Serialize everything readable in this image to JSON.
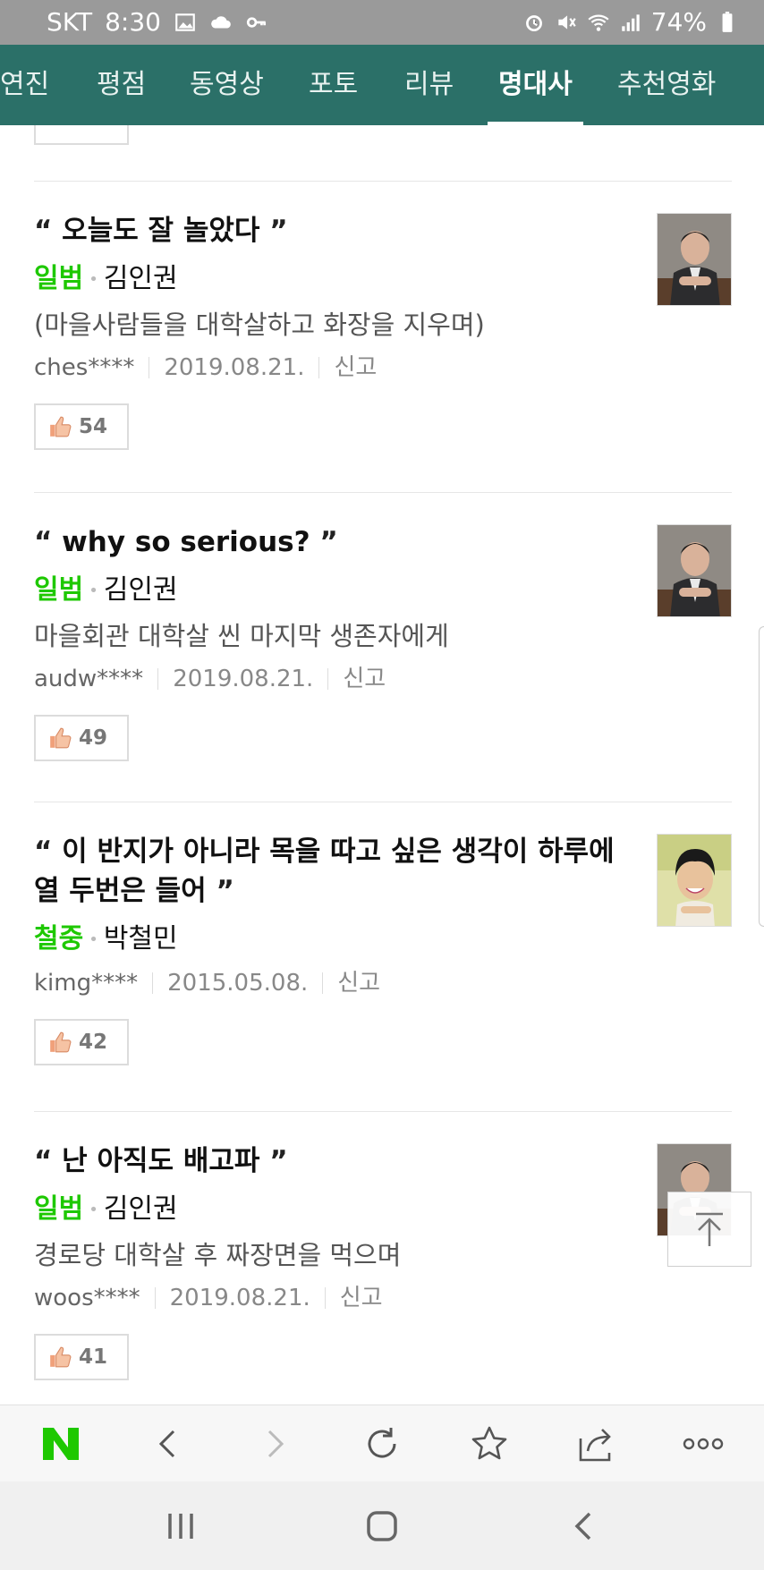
{
  "status_bar": {
    "carrier": "SKT",
    "time": "8:30",
    "battery": "74%"
  },
  "tabs": [
    {
      "label": "연진",
      "active": false
    },
    {
      "label": "평점",
      "active": false
    },
    {
      "label": "동영상",
      "active": false
    },
    {
      "label": "포토",
      "active": false
    },
    {
      "label": "리뷰",
      "active": false
    },
    {
      "label": "명대사",
      "active": true
    },
    {
      "label": "추천영화",
      "active": false
    }
  ],
  "open_quote": "“",
  "close_quote": "”",
  "report_label": "신고",
  "lines": [
    {
      "quote": "오늘도 잘 놀았다",
      "role": "일범",
      "actor": "김인권",
      "description": "(마을사람들을 대학살하고 화장을 지우며)",
      "user": "ches****",
      "date": "2019.08.21.",
      "likes": "54"
    },
    {
      "quote": "why so serious?",
      "role": "일범",
      "actor": "김인권",
      "description": "마을회관 대학살 씬 마지막 생존자에게",
      "user": "audw****",
      "date": "2019.08.21.",
      "likes": "49"
    },
    {
      "quote": "이 반지가 아니라 목을 따고 싶은 생각이 하루에 열 두번은 들어",
      "role": "철중",
      "actor": "박철민",
      "description": "",
      "user": "kimg****",
      "date": "2015.05.08.",
      "likes": "42"
    },
    {
      "quote": "난 아직도 배고파",
      "role": "일범",
      "actor": "김인권",
      "description": "경로당 대학살 후 짜장면을 먹으며",
      "user": "woos****",
      "date": "2019.08.21.",
      "likes": "41"
    }
  ],
  "colors": {
    "tab_bar": "#2b7068",
    "role": "#1ec800",
    "naver": "#1ec800"
  },
  "icons": {
    "toolbar": [
      "naver-logo",
      "back-icon",
      "forward-icon",
      "refresh-icon",
      "bookmark-star-icon",
      "share-icon",
      "more-icon"
    ],
    "system": [
      "recent-apps-icon",
      "home-icon",
      "system-back-icon"
    ]
  }
}
